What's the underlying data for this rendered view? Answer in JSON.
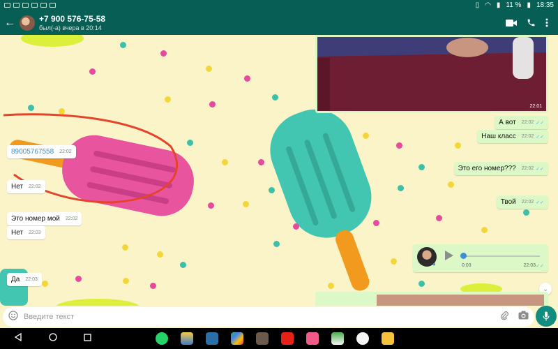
{
  "status_bar": {
    "battery": "11 %",
    "time": "18:35"
  },
  "header": {
    "contact": "+7 900 576-75-58",
    "last_seen": "был(-а) вчера в 20:14"
  },
  "image_message": {
    "time": "22:01"
  },
  "messages": [
    {
      "text": "89005767558",
      "time": "22:02"
    },
    {
      "text": "Нет",
      "time": "22:02"
    },
    {
      "text": "Это номер мой",
      "time": "22:02"
    },
    {
      "text": "Нет",
      "time": "22:03"
    },
    {
      "text": "Да",
      "time": "22:03"
    },
    {
      "text": "А вот",
      "time": "22:02"
    },
    {
      "text": "Наш класс",
      "time": "22:02"
    },
    {
      "text": "Это его номер???",
      "time": "22:02"
    },
    {
      "text": "Твой",
      "time": "22:02"
    }
  ],
  "voice_message": {
    "duration": "0:03",
    "time": "22:03"
  },
  "input": {
    "placeholder": "Введите текст"
  },
  "colors": {
    "header": "#075e54",
    "outgoing_bubble": "#dcf8c6",
    "incoming_bubble": "#ffffff",
    "wallpaper": "#fbf4c8",
    "mic_button": "#128c7e"
  }
}
